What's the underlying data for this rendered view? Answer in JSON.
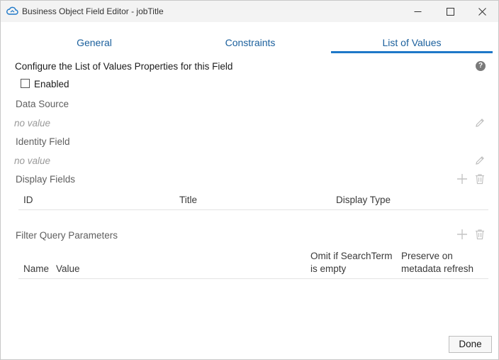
{
  "window": {
    "title": "Business Object Field Editor - jobTitle",
    "controls": [
      "minimize-icon",
      "maximize-icon",
      "close-icon"
    ]
  },
  "tabs": [
    {
      "label": "General",
      "active": false
    },
    {
      "label": "Constraints",
      "active": false
    },
    {
      "label": "List of Values",
      "active": true
    }
  ],
  "content": {
    "heading": "Configure the List of Values Properties for this Field",
    "enabled": {
      "label": "Enabled",
      "checked": false
    },
    "data_source": {
      "label": "Data Source",
      "value": "no value"
    },
    "identity_field": {
      "label": "Identity Field",
      "value": "no value"
    },
    "display_fields": {
      "label": "Display Fields",
      "columns": [
        "ID",
        "Title",
        "Display Type"
      ],
      "rows": []
    },
    "filter_query": {
      "label": "Filter Query Parameters",
      "columns": [
        "Name",
        "Value",
        "Omit if SearchTerm is empty",
        "Preserve on metadata refresh"
      ],
      "rows": []
    }
  },
  "footer": {
    "done_label": "Done"
  },
  "colors": {
    "accent": "#1e78c8",
    "tab_text": "#1a5f9c",
    "muted": "#9a9a9a"
  }
}
